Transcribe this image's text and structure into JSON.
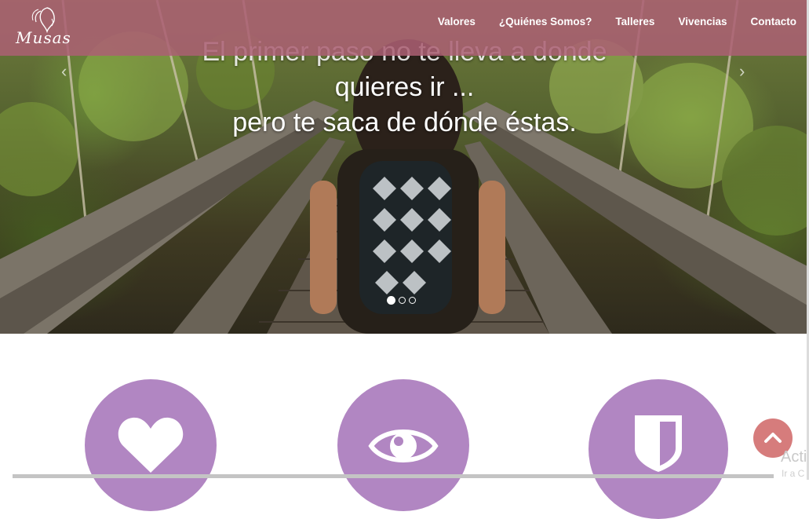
{
  "brand": {
    "name": "Musas"
  },
  "nav": {
    "items": [
      {
        "label": "Valores"
      },
      {
        "label": "¿Quiénes Somos?"
      },
      {
        "label": "Talleres"
      },
      {
        "label": "Vivencias"
      },
      {
        "label": "Contacto"
      }
    ]
  },
  "hero": {
    "caption_line1": "El primer paso no te lleva a donde",
    "caption_line2": "quieres ir ...",
    "caption_line3": "pero te saca de dónde éstas.",
    "prev_icon": "chevron-left-icon",
    "next_icon": "chevron-right-icon",
    "slides_total": 3,
    "active_slide": 1
  },
  "features": [
    {
      "icon": "heart-icon"
    },
    {
      "icon": "eye-icon"
    },
    {
      "icon": "shield-icon"
    }
  ],
  "colors": {
    "nav_bg": "#ab6073",
    "feature_circle": "#b186c2",
    "scroll_top": "#d67c7c"
  },
  "overlay": {
    "activate_text": "Activ",
    "activate_sub": "Ir a C"
  }
}
